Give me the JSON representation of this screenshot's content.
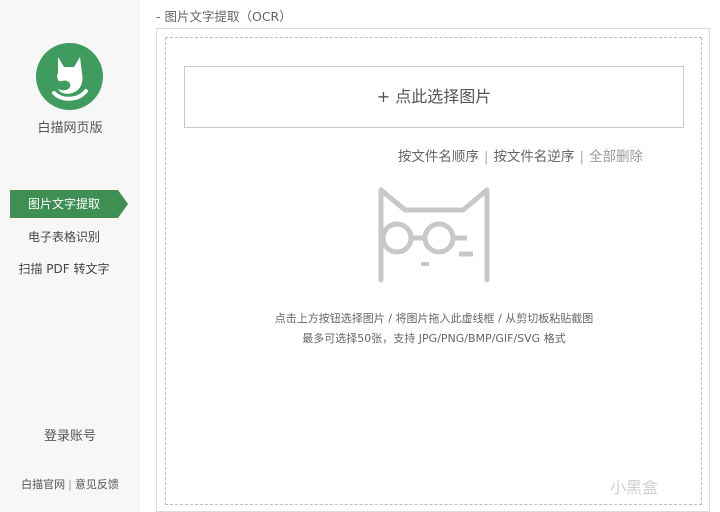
{
  "sidebar": {
    "brand_label": "白描网页版",
    "nav": [
      {
        "label": "图片文字提取",
        "active": true
      },
      {
        "label": "电子表格识别",
        "active": false
      },
      {
        "label": "扫描 PDF 转文字",
        "active": false
      }
    ],
    "login_label": "登录账号",
    "footer": {
      "official_site": "白描官网",
      "separator": "|",
      "feedback": "意见反馈"
    }
  },
  "main": {
    "section_title": "- 图片文字提取（OCR）",
    "select_button_label": "+ 点此选择图片",
    "sort": {
      "by_name_asc": "按文件名顺序",
      "by_name_desc": "按文件名逆序",
      "delete_all": "全部删除",
      "separator": "|"
    },
    "hint_line1": "点击上方按钮选择图片 / 将图片拖入此虚线框 / 从剪切板粘贴截图",
    "hint_line2": "最多可选择50张，支持 JPG/PNG/BMP/GIF/SVG 格式"
  },
  "watermark": "小黑盒",
  "colors": {
    "accent_green": "#3f8f55",
    "logo_green": "#3f9b5e"
  },
  "icons": {
    "logo": "cat-logo-icon",
    "illustration": "cat-glasses-icon"
  }
}
